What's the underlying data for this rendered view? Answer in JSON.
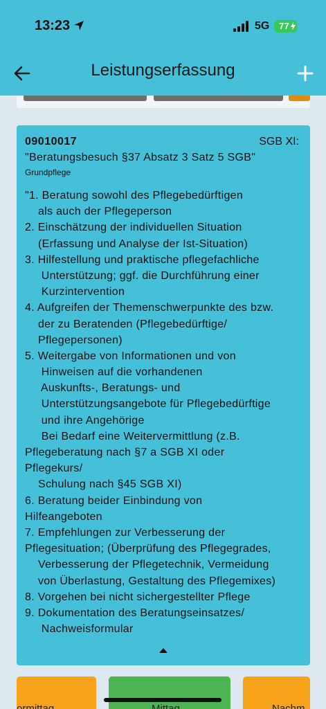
{
  "status_bar": {
    "time": "13:23",
    "network": "5G",
    "battery": "77"
  },
  "header": {
    "title": "Leistungserfassung"
  },
  "icons": {
    "back": "arrow-left-icon",
    "add": "plus-icon",
    "collapse": "caret-up-icon"
  },
  "card": {
    "code": "09010017",
    "law": "SGB XI:",
    "name": "\"Beratungsbesuch  §37 Absatz 3 Satz 5 SGB\"",
    "category": "Grundpflege",
    "description_lines": [
      "\"1. Beratung sowohl des Pflegebedürftigen",
      "    als auch der Pflegeperson",
      "2. Einschätzung der individuellen Situation",
      "    (Erfassung und Analyse der Ist-Situation)",
      "3. Hilfestellung und praktische pflegefachliche",
      "     Unterstützung; ggf. die Durchführung einer",
      "     Kurzintervention",
      "4. Aufgreifen der Themenschwerpunkte des bzw.",
      "    der zu Beratenden (Pflegebedürftige/",
      "    Pflegepersonen)",
      "5. Weitergabe von Informationen und von",
      "     Hinweisen auf die vorhandenen",
      "     Auskunfts-, Beratungs- und",
      "     Unterstützungsangebote für Pflegebedürftige",
      "     und ihre Angehörige",
      "     Bei Bedarf eine Weitervermittlung (z.B.",
      "Pflegeberatung nach §7 a SGB XI oder",
      "Pflegekurs/",
      "    Schulung nach §45 SGB XI)",
      "6. Beratung beider Einbindung von",
      "Hilfeangeboten",
      "7. Empfehlungen zur Verbesserung der",
      "Pflegesituation; (Überprüfung des Pflegegrades,",
      "    Verbesserung der Pflegetechnik, Vermeidung",
      "    von Überlastung, Gestaltung des Pflegemixes)",
      "8. Vorgehen bei nicht sichergestellter Pflege",
      "9. Dokumentation des Beratungseinsatzes/",
      "     Nachweisformular"
    ]
  },
  "bottom_buttons": {
    "left": "ormittag",
    "middle": "Mittag",
    "right": "Nachm"
  },
  "colors": {
    "header": "#46bfd9",
    "card": "#46bfd9",
    "background": "#dde9ef",
    "orange": "#f7a21b",
    "green": "#4cb452"
  }
}
